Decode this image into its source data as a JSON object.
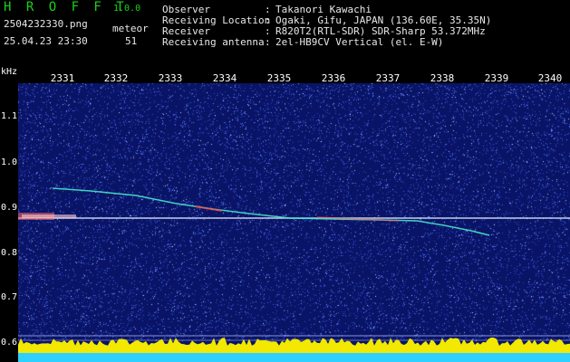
{
  "header": {
    "app_title": "H R O F F T",
    "version": "1.0.0",
    "filename": "2504232330.png",
    "meteor_label": "meteor",
    "datetime": "25.04.23 23:30",
    "meteor_count": "51"
  },
  "info": [
    {
      "key": "Observer",
      "value": "Takanori Kawachi"
    },
    {
      "key": "Receiving Location",
      "value": "Ogaki, Gifu, JAPAN (136.60E, 35.35N)"
    },
    {
      "key": "Receiver",
      "value": "R820T2(RTL-SDR) SDR-Sharp 53.372MHz"
    },
    {
      "key": "Receiving antenna",
      "value": "2el-HB9CV Vertical (el. E-W)"
    }
  ],
  "axis": {
    "unit": "kHz",
    "x_ticks": [
      "2331",
      "2332",
      "2333",
      "2334",
      "2335",
      "2336",
      "2337",
      "2338",
      "2339",
      "2340"
    ],
    "y_ticks": [
      "1.1",
      "1.0",
      "0.9",
      "0.8",
      "0.7",
      "0.6"
    ]
  },
  "colors": {
    "background": "#0a1466",
    "carrier": "#ffffff",
    "trace": "#44e0c8",
    "hot": "#ff3a3a",
    "baseline_fill": "#f2e800",
    "baseline_floor": "#2fd0ff"
  }
}
